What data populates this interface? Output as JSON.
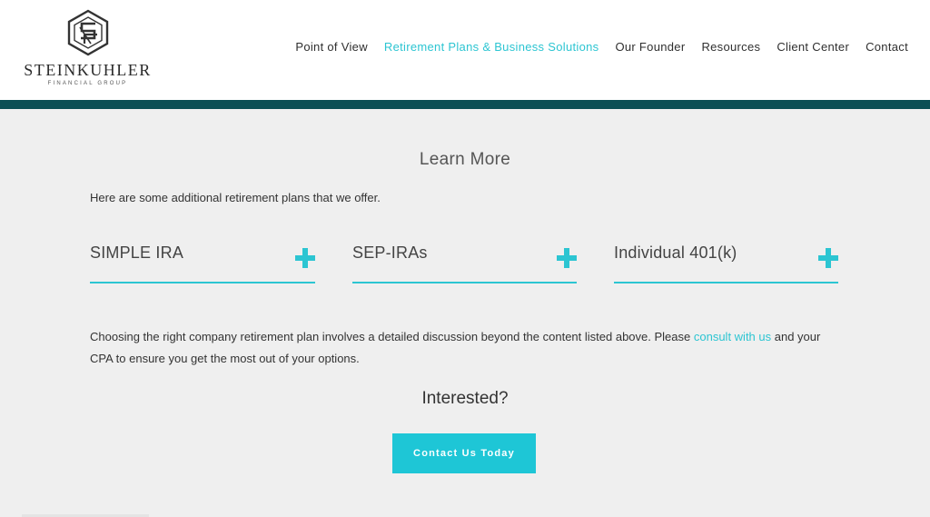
{
  "brand": {
    "name": "STEINKUHLER",
    "subtitle": "FINANCIAL GROUP",
    "logo_icon": "interlocking-sfg-hexagon-icon"
  },
  "nav": {
    "items": [
      {
        "label": "Point of View"
      },
      {
        "label": "Retirement Plans & Business Solutions",
        "active": true
      },
      {
        "label": "Our Founder"
      },
      {
        "label": "Resources"
      },
      {
        "label": "Client Center"
      },
      {
        "label": "Contact"
      }
    ]
  },
  "main": {
    "title": "Learn More",
    "intro": "Here are some additional retirement plans that we offer.",
    "accordions": [
      {
        "title": "SIMPLE IRA",
        "icon": "plus-icon"
      },
      {
        "title": "SEP-IRAs",
        "icon": "plus-icon"
      },
      {
        "title": "Individual 401(k)",
        "icon": "plus-icon"
      }
    ],
    "body_before": "Choosing the right company retirement plan involves a detailed discussion beyond the content listed above. Please ",
    "body_link": "consult with us",
    "body_after": " and your CPA to ensure you get the most out of your options.",
    "interested": "Interested?",
    "cta_label": "Contact Us Today"
  },
  "colors": {
    "accent": "#2cc5d2",
    "button": "#1ec6d6",
    "dark_bar": "#0c4f54",
    "background": "#efefef"
  }
}
